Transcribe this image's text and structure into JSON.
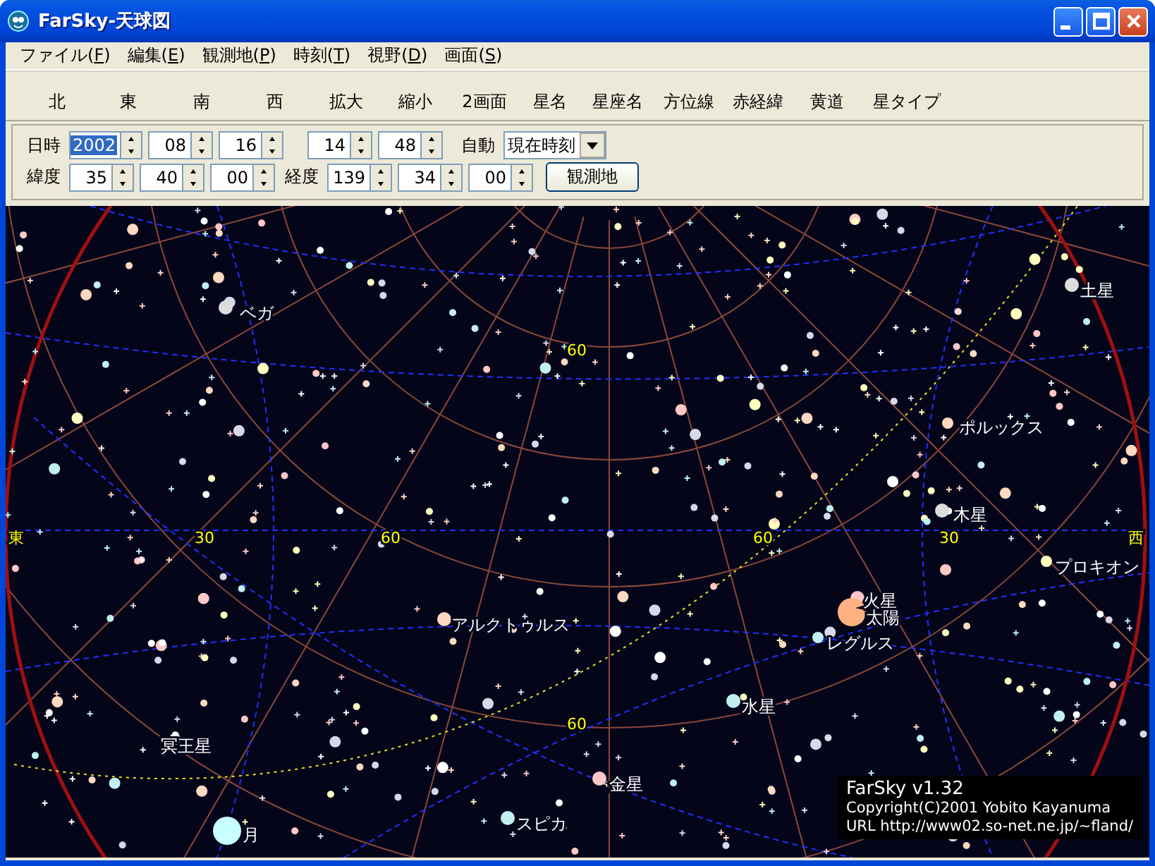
{
  "window": {
    "title": "FarSky-天球図"
  },
  "menu": [
    "ファイル(F)",
    "編集(E)",
    "観測地(P)",
    "時刻(T)",
    "視野(D)",
    "画面(S)"
  ],
  "toolbar": [
    "北",
    "東",
    "南",
    "西",
    "拡大",
    "縮小",
    "2画面",
    "星名",
    "星座名",
    "方位線",
    "赤経緯",
    "黄道",
    "星タイプ"
  ],
  "datetime": {
    "label": "日時",
    "fields": [
      {
        "value": "2002",
        "selected": true
      },
      {
        "value": "08",
        "selected": false
      },
      {
        "value": "16",
        "selected": false
      },
      {
        "value": "14",
        "selected": false
      },
      {
        "value": "48",
        "selected": false
      }
    ],
    "auto_label": "自動",
    "mode": "現在時刻"
  },
  "location": {
    "lat_label": "緯度",
    "lat": [
      "35",
      "40",
      "00"
    ],
    "lon_label": "経度",
    "lon": [
      "139",
      "34",
      "00"
    ],
    "button": "観測地"
  },
  "sky": {
    "labels": [
      {
        "text": "ベガ",
        "kind": "body"
      },
      {
        "text": "60",
        "kind": "grid"
      },
      {
        "text": "土星",
        "kind": "body"
      },
      {
        "text": "ポルックス",
        "kind": "body"
      },
      {
        "text": "木星",
        "kind": "body"
      },
      {
        "text": "東",
        "kind": "direction"
      },
      {
        "text": "30",
        "kind": "grid"
      },
      {
        "text": "60",
        "kind": "grid"
      },
      {
        "text": "60",
        "kind": "grid"
      },
      {
        "text": "30",
        "kind": "grid"
      },
      {
        "text": "西",
        "kind": "direction"
      },
      {
        "text": "プロキオン",
        "kind": "body"
      },
      {
        "text": "火星",
        "kind": "body"
      },
      {
        "text": "太陽",
        "kind": "body"
      },
      {
        "text": "アルクトゥルス",
        "kind": "body"
      },
      {
        "text": "レグルス",
        "kind": "body"
      },
      {
        "text": "水星",
        "kind": "body"
      },
      {
        "text": "60",
        "kind": "grid"
      },
      {
        "text": "冥王星",
        "kind": "body"
      },
      {
        "text": "金星",
        "kind": "body"
      },
      {
        "text": "月",
        "kind": "body"
      },
      {
        "text": "スピカ",
        "kind": "body"
      }
    ],
    "credits": [
      "FarSky v1.32",
      "Copyright(C)2001 Yobito Kayanuma",
      "URL http://www02.so-net.ne.jp/~fland/"
    ]
  }
}
